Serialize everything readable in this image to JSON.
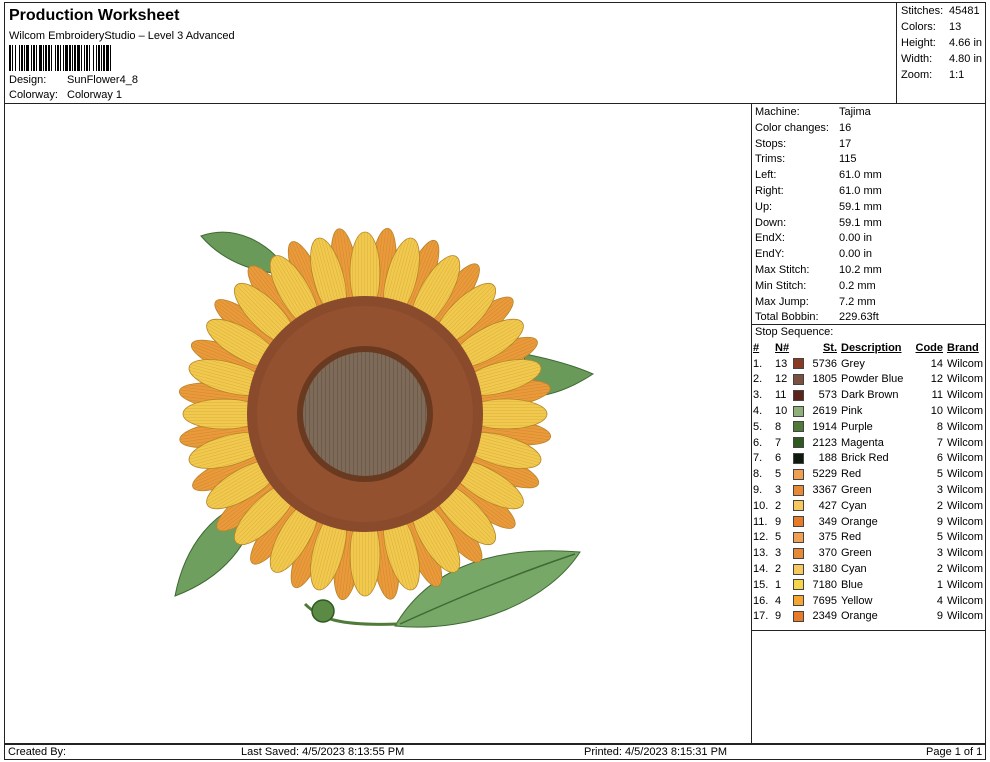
{
  "header": {
    "title": "Production Worksheet",
    "software": "Wilcom EmbroideryStudio – Level 3 Advanced",
    "design_label": "Design:",
    "design_value": "SunFlower4_8",
    "colorway_label": "Colorway:",
    "colorway_value": "Colorway 1"
  },
  "stats": [
    {
      "label": "Stitches:",
      "value": "45481"
    },
    {
      "label": "Colors:",
      "value": "13"
    },
    {
      "label": "Height:",
      "value": "4.66 in"
    },
    {
      "label": "Width:",
      "value": "4.80 in"
    },
    {
      "label": "Zoom:",
      "value": "1:1"
    }
  ],
  "machine": [
    {
      "label": "Machine:",
      "value": "Tajima"
    },
    {
      "label": "Color changes:",
      "value": "16"
    },
    {
      "label": "Stops:",
      "value": "17"
    },
    {
      "label": "Trims:",
      "value": "115"
    },
    {
      "label": "Left:",
      "value": "61.0 mm"
    },
    {
      "label": "Right:",
      "value": "61.0 mm"
    },
    {
      "label": "Up:",
      "value": "59.1 mm"
    },
    {
      "label": "Down:",
      "value": "59.1 mm"
    },
    {
      "label": "EndX:",
      "value": "0.00 in"
    },
    {
      "label": "EndY:",
      "value": "0.00 in"
    },
    {
      "label": "Max Stitch:",
      "value": "10.2 mm"
    },
    {
      "label": "Min Stitch:",
      "value": "0.2 mm"
    },
    {
      "label": "Max Jump:",
      "value": "7.2 mm"
    },
    {
      "label": "Total Bobbin:",
      "value": "229.63ft"
    }
  ],
  "stop_sequence": {
    "title": "Stop Sequence:",
    "headers": [
      "#",
      "N#",
      "St.",
      "Description",
      "Code",
      "Brand"
    ],
    "rows": [
      {
        "num": "1.",
        "n": "13",
        "color": "#8a3a22",
        "st": "5736",
        "desc": "Grey",
        "code": "14",
        "brand": "Wilcom"
      },
      {
        "num": "2.",
        "n": "12",
        "color": "#7a5040",
        "st": "1805",
        "desc": "Powder Blue",
        "code": "12",
        "brand": "Wilcom"
      },
      {
        "num": "3.",
        "n": "11",
        "color": "#5a2418",
        "st": "573",
        "desc": "Dark Brown",
        "code": "11",
        "brand": "Wilcom"
      },
      {
        "num": "4.",
        "n": "10",
        "color": "#8fb07a",
        "st": "2619",
        "desc": "Pink",
        "code": "10",
        "brand": "Wilcom"
      },
      {
        "num": "5.",
        "n": "8",
        "color": "#4f7a3a",
        "st": "1914",
        "desc": "Purple",
        "code": "8",
        "brand": "Wilcom"
      },
      {
        "num": "6.",
        "n": "7",
        "color": "#2e5a22",
        "st": "2123",
        "desc": "Magenta",
        "code": "7",
        "brand": "Wilcom"
      },
      {
        "num": "7.",
        "n": "6",
        "color": "#0e1a0c",
        "st": "188",
        "desc": "Brick Red",
        "code": "6",
        "brand": "Wilcom"
      },
      {
        "num": "8.",
        "n": "5",
        "color": "#f0a050",
        "st": "5229",
        "desc": "Red",
        "code": "5",
        "brand": "Wilcom"
      },
      {
        "num": "9.",
        "n": "3",
        "color": "#e88a35",
        "st": "3367",
        "desc": "Green",
        "code": "3",
        "brand": "Wilcom"
      },
      {
        "num": "10.",
        "n": "2",
        "color": "#f5c860",
        "st": "427",
        "desc": "Cyan",
        "code": "2",
        "brand": "Wilcom"
      },
      {
        "num": "11.",
        "n": "9",
        "color": "#e87a28",
        "st": "349",
        "desc": "Orange",
        "code": "9",
        "brand": "Wilcom"
      },
      {
        "num": "12.",
        "n": "5",
        "color": "#f0a050",
        "st": "375",
        "desc": "Red",
        "code": "5",
        "brand": "Wilcom"
      },
      {
        "num": "13.",
        "n": "3",
        "color": "#e88a35",
        "st": "370",
        "desc": "Green",
        "code": "3",
        "brand": "Wilcom"
      },
      {
        "num": "14.",
        "n": "2",
        "color": "#f5c860",
        "st": "3180",
        "desc": "Cyan",
        "code": "2",
        "brand": "Wilcom"
      },
      {
        "num": "15.",
        "n": "1",
        "color": "#f5d54a",
        "st": "7180",
        "desc": "Blue",
        "code": "1",
        "brand": "Wilcom"
      },
      {
        "num": "16.",
        "n": "4",
        "color": "#f5a530",
        "st": "7695",
        "desc": "Yellow",
        "code": "4",
        "brand": "Wilcom"
      },
      {
        "num": "17.",
        "n": "9",
        "color": "#e87a28",
        "st": "2349",
        "desc": "Orange",
        "code": "9",
        "brand": "Wilcom"
      }
    ]
  },
  "footer": {
    "created": "Created By:",
    "saved": "Last Saved: 4/5/2023 8:13:55 PM",
    "printed": "Printed: 4/5/2023 8:15:31 PM",
    "page": "Page 1 of 1"
  },
  "design_image": {
    "subject": "sunflower-embroidery",
    "colors": {
      "petal_yellow": "#f2c94c",
      "petal_orange": "#eb9a3a",
      "center_ring": "#8a4a2c",
      "center_disc": "#7a6a58",
      "leaf": "#6a9a5a",
      "leaf_dark": "#3f6a34"
    }
  }
}
